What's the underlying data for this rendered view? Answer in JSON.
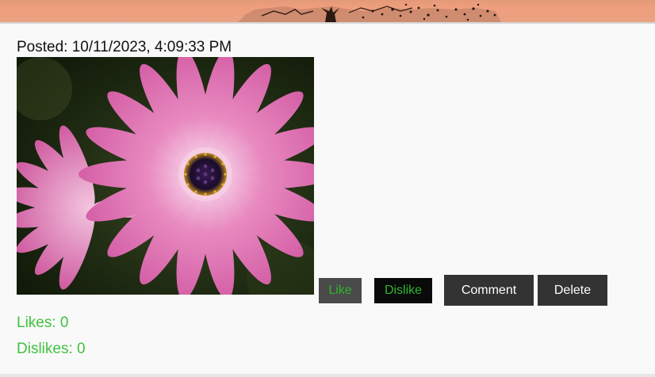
{
  "post": {
    "posted_label": "Posted:",
    "posted_value": "10/11/2023, 4:09:33 PM",
    "image_subject": "pink daisy flowers"
  },
  "actions": {
    "like_label": "Like",
    "dislike_label": "Dislike",
    "comment_label": "Comment",
    "delete_label": "Delete"
  },
  "stats": {
    "likes_label": "Likes:",
    "likes_count": "0",
    "dislikes_label": "Dislikes:",
    "dislikes_count": "0"
  },
  "colors": {
    "accent_green": "#3fc23f",
    "button_dark": "#333333",
    "banner": "#ef9e7d"
  }
}
